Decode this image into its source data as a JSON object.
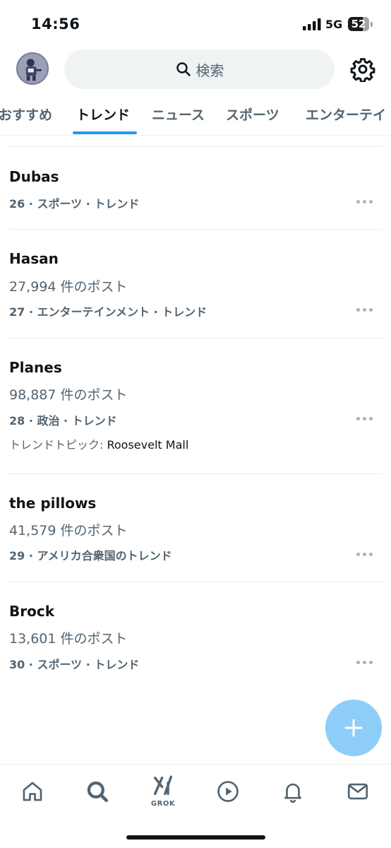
{
  "status_bar": {
    "time": "14:56",
    "network": "5G",
    "battery": "52"
  },
  "search": {
    "placeholder": "検索"
  },
  "tabs": [
    {
      "label": "おすすめ"
    },
    {
      "label": "トレンド"
    },
    {
      "label": "ニュース"
    },
    {
      "label": "スポーツ"
    },
    {
      "label": "エンターテイ"
    }
  ],
  "active_tab": "トレンド",
  "trends": [
    {
      "name": "Dubas",
      "posts": "",
      "meta": "26 · スポーツ · トレンド",
      "topic_label": "",
      "topic_value": ""
    },
    {
      "name": "Hasan",
      "posts": "27,994 件のポスト",
      "meta": "27 · エンターテインメント · トレンド",
      "topic_label": "",
      "topic_value": ""
    },
    {
      "name": "Planes",
      "posts": "98,887 件のポスト",
      "meta": "28 · 政治 · トレンド",
      "topic_label": "トレンドトピック: ",
      "topic_value": "Roosevelt Mall"
    },
    {
      "name": "the pillows",
      "posts": "41,579 件のポスト",
      "meta": "29 · アメリカ合衆国のトレンド",
      "topic_label": "",
      "topic_value": ""
    },
    {
      "name": "Brock",
      "posts": "13,601 件のポスト",
      "meta": "30 · スポーツ · トレンド",
      "topic_label": "",
      "topic_value": ""
    }
  ],
  "bottom_nav": {
    "grok_label": "GROK"
  },
  "colors": {
    "accent": "#1d9bf0",
    "fab": "#8ecdf8",
    "secondary_text": "#536471",
    "primary_text": "#0f1419"
  },
  "icons": [
    "avatar",
    "search-icon",
    "gear-icon",
    "more-icon",
    "plus-icon",
    "home-icon",
    "search-nav-icon",
    "grok-icon",
    "play-icon",
    "bell-icon",
    "mail-icon"
  ]
}
